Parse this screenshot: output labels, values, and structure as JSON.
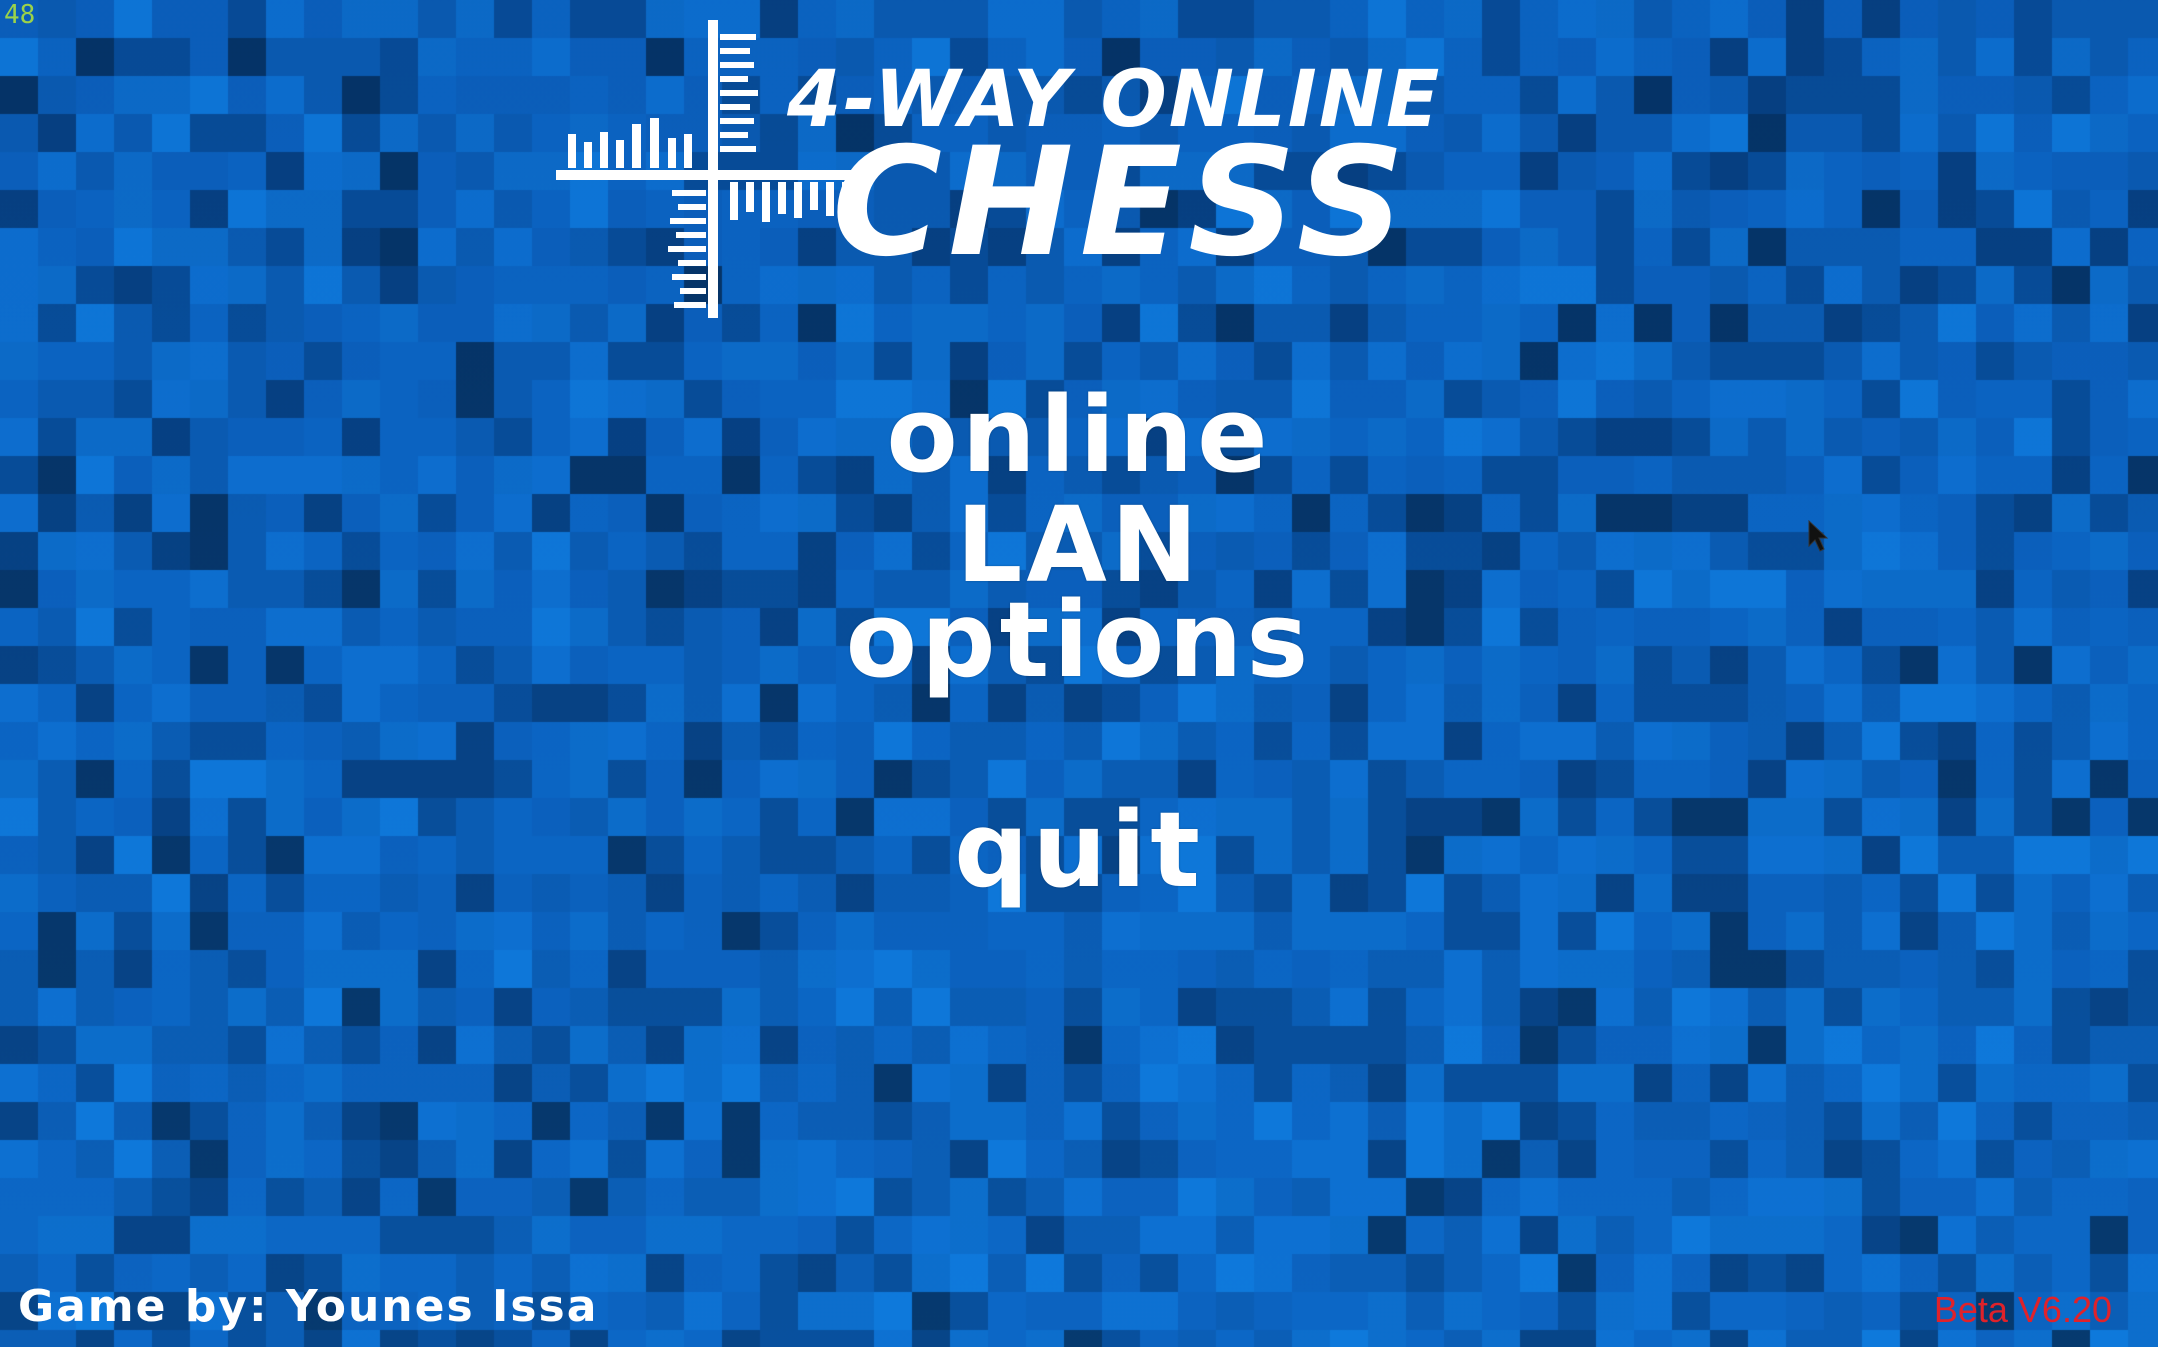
{
  "hud": {
    "fps": "48"
  },
  "logo": {
    "line1": "4-WAY ONLINE",
    "line2": "CHESS"
  },
  "menu": {
    "online": "online",
    "lan": "LAN",
    "options": "options",
    "quit": "quit"
  },
  "footer": {
    "credit": "Game by: Younes Issa",
    "version": "Beta V6.20"
  },
  "colors": {
    "background_base": "#0a5fb8",
    "menu_text": "#ffffff",
    "version_text": "#e0222a",
    "fps_text": "#9bd24a"
  },
  "icons": {
    "logo_mark": "chess-cross-icon",
    "pointer": "mouse-cursor-icon"
  }
}
